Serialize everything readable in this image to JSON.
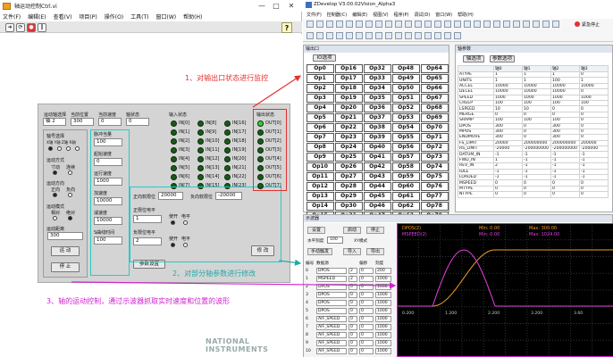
{
  "left_window": {
    "title": "轴运动控制Ctrl.vi",
    "menu": [
      "文件(F)",
      "编辑(E)",
      "查看(V)",
      "项目(P)",
      "操作(O)",
      "工具(T)",
      "窗口(W)",
      "帮助(H)"
    ],
    "win_controls": [
      "—",
      "□",
      "✕"
    ],
    "help_icon": "?",
    "brand_watermark": "NATIONAL INSTRUMENTS",
    "panel": {
      "headers": {
        "axis_select": "运动轴选择",
        "cur_pos": "当前位置",
        "cur_speed": "当前速度",
        "axis_state": "轴状态",
        "input_state": "输入状态",
        "output_state": "输出状态"
      },
      "header_values": {
        "axis_select": "轴 2",
        "cur_pos": "300",
        "cur_speed": "0",
        "axis_state": "0"
      },
      "left_box": {
        "axis_select_label": "轴号选择",
        "axis_options": "X轴 Y轴 Z轴 R轴",
        "motion_mode_label": "运动方式",
        "motion_mode_opts": [
          "寸动",
          "连续"
        ],
        "direction_label": "运动方向",
        "direction_opts": [
          "正向",
          "负向"
        ],
        "move_mode_label": "运动模式",
        "move_mode_opts": [
          "相对",
          "绝对"
        ],
        "distance_label": "运动距离",
        "distance_value": "300",
        "run_btn": "运 动",
        "stop_btn": "停 止"
      },
      "params": {
        "pulse_label": "脉冲当量",
        "pulse_value": "100",
        "start_speed_label": "起始速度",
        "start_speed_value": "0",
        "run_speed_label": "运行速度",
        "run_speed_value": "1000",
        "accel_label": "加速度",
        "accel_value": "10000",
        "decel_label": "减速度",
        "decel_value": "10000",
        "scurve_label": "S曲线时间",
        "scurve_value": "100",
        "apply_btn": "参数设置"
      },
      "limits": {
        "pos_limit_label": "正向软限位",
        "pos_limit_value": "20000",
        "neg_limit_label": "负向软限位",
        "neg_limit_value": "-20000",
        "pos_hw_label": "正限位电平",
        "pos_hw_value": "1",
        "neg_hw_label": "负限位电平",
        "neg_hw_value": "2",
        "enable1_label": "使开",
        "enable1_sub": "电平",
        "enable2_label": "使开",
        "enable2_sub": "电平",
        "modify_btn": "修 改"
      },
      "inputs": [
        "IN[0]",
        "IN[8]",
        "IN[16]",
        "IN[1]",
        "IN[9]",
        "IN[17]",
        "IN[2]",
        "IN[10]",
        "IN[18]",
        "IN[3]",
        "IN[11]",
        "IN[19]",
        "IN[4]",
        "IN[12]",
        "IN[20]",
        "IN[5]",
        "IN[13]",
        "IN[21]",
        "IN[6]",
        "IN[14]",
        "IN[22]",
        "IN[7]",
        "IN[15]",
        "IN[23]"
      ],
      "outputs": [
        "OUT[0]",
        "OUT[1]",
        "OUT[2]",
        "OUT[3]",
        "OUT[4]",
        "OUT[5]",
        "OUT[6]",
        "OUT[7]"
      ],
      "outputs_on": [
        1,
        0,
        0,
        0,
        0,
        0,
        0,
        0
      ]
    }
  },
  "annotations": {
    "a1": "1、对输出口状态进行监控",
    "a2": "2、对部分轴参数进行修改",
    "a3": "3、轴的运动控制，通过示波器抓取实时速度和位置的波形"
  },
  "right_window": {
    "title": "ZDevelop V3.00.02Vision_Alpha3",
    "menu": [
      "文件(F)",
      "控制器(C)",
      "编辑(E)",
      "视图(V)",
      "程序(P)",
      "调试(D)",
      "窗口(W)",
      "帮助(H)"
    ],
    "tb_label": "紧急停止",
    "outport_title": "输出口",
    "outport_tab": "IO选项",
    "outputs": [
      "Op0",
      "Op16",
      "Op32",
      "Op48",
      "Op64",
      "Op1",
      "Op17",
      "Op33",
      "Op49",
      "Op65",
      "Op2",
      "Op18",
      "Op34",
      "Op50",
      "Op66",
      "Op3",
      "Op19",
      "Op35",
      "Op51",
      "Op67",
      "Op4",
      "Op20",
      "Op36",
      "Op52",
      "Op68",
      "Op5",
      "Op21",
      "Op37",
      "Op53",
      "Op69",
      "Op6",
      "Op22",
      "Op38",
      "Op54",
      "Op70",
      "Op7",
      "Op23",
      "Op39",
      "Op55",
      "Op71",
      "Op8",
      "Op24",
      "Op40",
      "Op56",
      "Op72",
      "Op9",
      "Op25",
      "Op41",
      "Op57",
      "Op73",
      "Op10",
      "Op26",
      "Op42",
      "Op58",
      "Op74",
      "Op11",
      "Op27",
      "Op43",
      "Op59",
      "Op75",
      "Op12",
      "Op28",
      "Op44",
      "Op60",
      "Op76",
      "Op13",
      "Op29",
      "Op45",
      "Op61",
      "Op77",
      "Op14",
      "Op30",
      "Op46",
      "Op62",
      "Op78",
      "Op15",
      "Op31",
      "Op47",
      "Op63",
      "Op79"
    ],
    "axpar_title": "轴参数",
    "axpar_tabs": [
      "轴选项",
      "参数选项"
    ],
    "axpar_cols": [
      "",
      "轴0",
      "轴1",
      "轴2",
      "轴3"
    ],
    "axpar_rows": [
      [
        "ATYPE",
        "1",
        "1",
        "1",
        "0"
      ],
      [
        "UNITS",
        "1",
        "1",
        "100",
        "1"
      ],
      [
        "ACCEL",
        "10000",
        "10000",
        "10000",
        "10000"
      ],
      [
        "DECEL",
        "10000",
        "10000",
        "10000",
        "0"
      ],
      [
        "SPEED",
        "1000",
        "1000",
        "1000",
        "1000"
      ],
      [
        "CREEP",
        "100",
        "100",
        "100",
        "100"
      ],
      [
        "LSPEED",
        "10",
        "10",
        "0",
        "0"
      ],
      [
        "MERGE",
        "0",
        "0",
        "0",
        "0"
      ],
      [
        "SRAMP",
        "100",
        "100",
        "100",
        "0"
      ],
      [
        "DPOS",
        "300",
        "0",
        "300",
        "0"
      ],
      [
        "MPOS",
        "300",
        "0",
        "300",
        "0"
      ],
      [
        "ENDMOVE",
        "300",
        "0",
        "300",
        "0"
      ],
      [
        "FS_LIMIT",
        "20000",
        "200000000",
        "200000000",
        "200000"
      ],
      [
        "RS_LIMIT",
        "-20000",
        "-200000000",
        "-200000000",
        "-200000"
      ],
      [
        "DATUM_IN",
        "-1",
        "-1",
        "-1",
        "-1"
      ],
      [
        "FWD_IN",
        "1",
        "-1",
        "-1",
        "-1"
      ],
      [
        "REV_IN",
        "2",
        "-1",
        "-1",
        "-1"
      ],
      [
        "IDLE",
        "-1",
        "-1",
        "-1",
        "-1"
      ],
      [
        "LOADED",
        "-1",
        "-1",
        "-1",
        "-1"
      ],
      [
        "MSPEED",
        "0",
        "0",
        "0",
        "0"
      ],
      [
        "MTYPE",
        "0",
        "0",
        "0",
        "0"
      ],
      [
        "NTYPE",
        "0",
        "0",
        "0",
        "0"
      ]
    ],
    "scope": {
      "title": "示波器",
      "btns": {
        "settings": "设置",
        "start": "启动",
        "stop": "停止",
        "manual": "手动触发",
        "import": "导入",
        "export": "导出"
      },
      "depth_label": "水平刻度",
      "depth_value": "100",
      "xy_label": "XY模式",
      "col_headers": [
        "编号",
        "数据源",
        "",
        "偏移",
        "刻度"
      ],
      "rows": [
        [
          "0",
          "DPOS",
          "2",
          "0",
          "200"
        ],
        [
          "1",
          "MSPEED",
          "2",
          "0",
          "1000"
        ],
        [
          "2",
          "DPOS",
          "0",
          "0",
          "1000"
        ],
        [
          "3",
          "DPOS",
          "0",
          "0",
          "1000"
        ],
        [
          "4",
          "DPOS",
          "0",
          "0",
          "1000"
        ],
        [
          "5",
          "DPOS",
          "0",
          "0",
          "1000"
        ],
        [
          "6",
          "AIF_SPEED",
          "0",
          "0",
          "1000"
        ],
        [
          "7",
          "AIF_SPEED",
          "0",
          "0",
          "1000"
        ],
        [
          "8",
          "AIF_SPEED",
          "0",
          "0",
          "1000"
        ],
        [
          "9",
          "AIF_SPEED",
          "0",
          "0",
          "1000"
        ],
        [
          "10",
          "AIF_SPEED",
          "0",
          "0",
          "1000"
        ]
      ],
      "legend1": "DPOS(2)",
      "legend2": "MSPEED(2)",
      "min1": "Min: 0.00",
      "max1": "Max: 300.00",
      "min2": "Min: 0.00",
      "max2": "Max: 1024.00",
      "xticks": [
        "0.200",
        "1.200",
        "2.200",
        "3.200",
        "3.60"
      ]
    }
  },
  "colors": {
    "red": "#e53030",
    "cyan": "#22aaa8",
    "magenta": "#d020d0",
    "led_on": "#39d039",
    "led_off": "#1a5a1a"
  }
}
